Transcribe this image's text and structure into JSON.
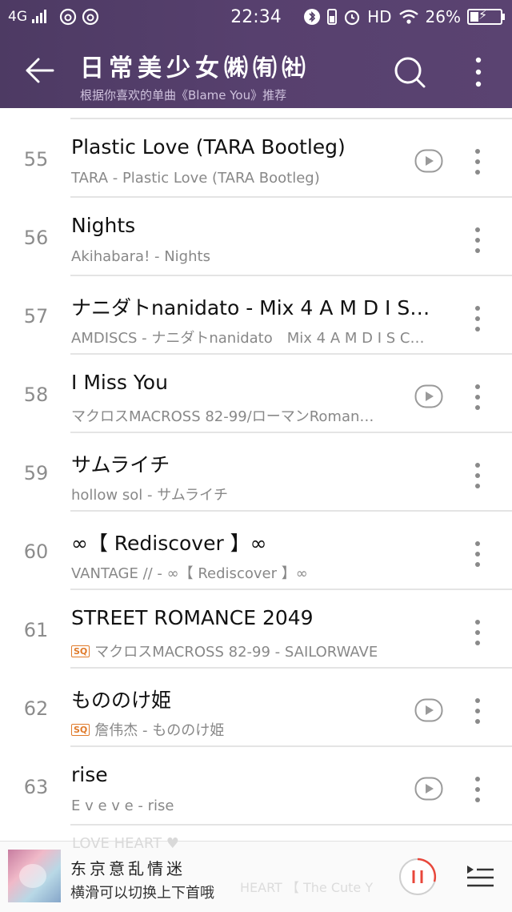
{
  "status": {
    "network": "4G",
    "time": "22:34",
    "hd": "HD",
    "battery": "26%"
  },
  "header": {
    "title": "日常美少女㈱㈲㈳",
    "subtitle": "根据你喜欢的单曲《Blame You》推荐"
  },
  "songs": [
    {
      "num": "55",
      "title": "Plastic Love (TARA Bootleg)",
      "artist": "TARA - Plastic Love (TARA Bootleg)",
      "sq": false,
      "play": true
    },
    {
      "num": "56",
      "title": "Nights",
      "artist": "Akihabara! - Nights",
      "sq": false,
      "play": false
    },
    {
      "num": "57",
      "title": "ナニダトnanidato - Mix 4 A M D I S…",
      "artist": "AMDISCS - ナニダトnanidato　Mix 4 A M D I S C…",
      "sq": false,
      "play": false
    },
    {
      "num": "58",
      "title": "I Miss You",
      "artist": "マクロスMACROSS 82-99/ローマンRoman…",
      "sq": false,
      "play": true
    },
    {
      "num": "59",
      "title": "サムライチ",
      "artist": "hollow sol - サムライチ",
      "sq": false,
      "play": false
    },
    {
      "num": "60",
      "title": "∞【 Rediscover 】∞",
      "artist": "VANTAGE // - ∞【 Rediscover 】∞",
      "sq": false,
      "play": false
    },
    {
      "num": "61",
      "title": "STREET ROMANCE 2049",
      "artist": "マクロスMACROSS 82-99 - SAILORWAVE",
      "sq": true,
      "play": false
    },
    {
      "num": "62",
      "title": "もののけ姫",
      "artist": "詹伟杰 - もののけ姫",
      "sq": true,
      "play": true
    },
    {
      "num": "63",
      "title": "rise",
      "artist": "E v e v e - rise",
      "sq": false,
      "play": true
    }
  ],
  "sq_label": "SQ",
  "player": {
    "title": "东京意乱情迷",
    "subtitle": "横滑可以切换上下首哦",
    "ghost_top": "LOVE HEART ♥",
    "ghost_bottom": "HEART 【 The Cute Y"
  }
}
